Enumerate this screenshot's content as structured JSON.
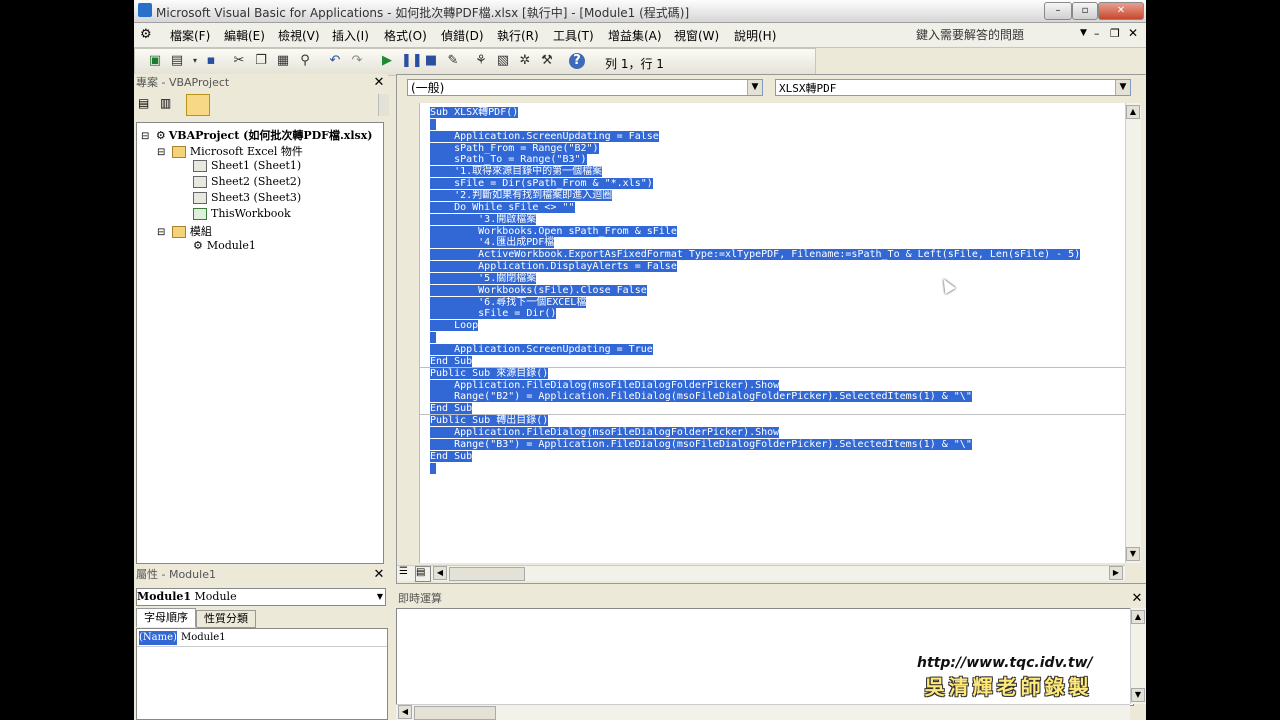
{
  "window": {
    "title": "Microsoft Visual Basic for Applications - 如何批次轉PDF檔.xlsx [執行中] - [Module1 (程式碼)]"
  },
  "menu": [
    "檔案(F)",
    "編輯(E)",
    "檢視(V)",
    "插入(I)",
    "格式(O)",
    "偵錯(D)",
    "執行(R)",
    "工具(T)",
    "增益集(A)",
    "視窗(W)",
    "說明(H)"
  ],
  "help_box": "鍵入需要解答的問題",
  "toolbar": {
    "cursor_position": "列 1，行 1"
  },
  "project": {
    "title": "專案 - VBAProject",
    "tree": [
      {
        "label": "VBAProject (如何批次轉PDF檔.xlsx)",
        "indent": 0,
        "icon": "project-icon",
        "toggle": "⊟",
        "bold": true
      },
      {
        "label": "Microsoft Excel 物件",
        "indent": 1,
        "icon": "folder-icon",
        "toggle": "⊟"
      },
      {
        "label": "Sheet1 (Sheet1)",
        "indent": 2,
        "icon": "sheet-icon"
      },
      {
        "label": "Sheet2 (Sheet2)",
        "indent": 2,
        "icon": "sheet-icon"
      },
      {
        "label": "Sheet3 (Sheet3)",
        "indent": 2,
        "icon": "sheet-icon"
      },
      {
        "label": "ThisWorkbook",
        "indent": 2,
        "icon": "workbook-icon"
      },
      {
        "label": "模組",
        "indent": 1,
        "icon": "folder-icon",
        "toggle": "⊟"
      },
      {
        "label": "Module1",
        "indent": 2,
        "icon": "module-icon"
      }
    ]
  },
  "properties": {
    "title": "屬性 - Module1",
    "object_name": "Module1",
    "object_type": "Module",
    "tabs": [
      "字母順序",
      "性質分類"
    ],
    "row_name": "(Name)",
    "row_value": "Module1"
  },
  "code": {
    "object_combo": "(一般)",
    "proc_combo": "XLSX轉PDF",
    "lines": [
      "Sub XLSX轉PDF()",
      "",
      "    Application.ScreenUpdating = False",
      "    sPath_From = Range(\"B2\")",
      "    sPath_To = Range(\"B3\")",
      "    '1.取得來源目錄中的第一個檔案",
      "    sFile = Dir(sPath_From & \"*.xls\")",
      "    '2.判斷如果有找到檔案即進入迴圈",
      "    Do While sFile <> \"\"",
      "        '3.開啟檔案",
      "        Workbooks.Open sPath_From & sFile",
      "        '4.匯出成PDF檔",
      "        ActiveWorkbook.ExportAsFixedFormat Type:=xlTypePDF, Filename:=sPath_To & Left(sFile, Len(sFile) - 5)",
      "        Application.DisplayAlerts = False",
      "        '5.關閉檔案",
      "        Workbooks(sFile).Close False",
      "        '6.尋找下一個EXCEL檔",
      "        sFile = Dir()",
      "    Loop",
      "",
      "    Application.ScreenUpdating = True",
      "End Sub",
      "Public Sub 來源目錄()",
      "    Application.FileDialog(msoFileDialogFolderPicker).Show",
      "    Range(\"B2\") = Application.FileDialog(msoFileDialogFolderPicker).SelectedItems(1) & \"\\\"",
      "End Sub",
      "Public Sub 轉出目錄()",
      "    Application.FileDialog(msoFileDialogFolderPicker).Show",
      "    Range(\"B3\") = Application.FileDialog(msoFileDialogFolderPicker).SelectedItems(1) & \"\\\"",
      "End Sub",
      ""
    ]
  },
  "immediate": {
    "title": "即時運算",
    "watermark_url": "http://www.tqc.idv.tw/",
    "watermark_author": "吳清輝老師錄製"
  }
}
